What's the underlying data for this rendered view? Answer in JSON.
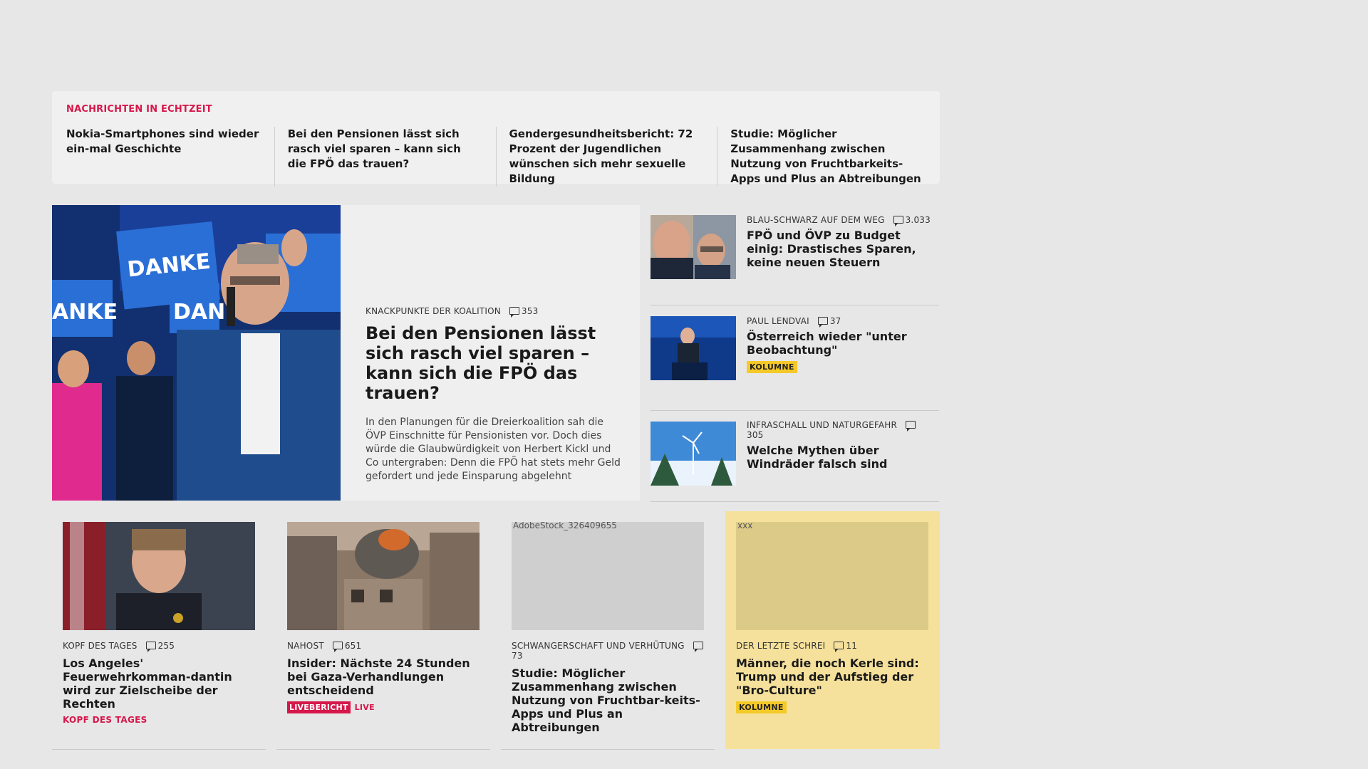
{
  "ticker": {
    "title": "NACHRICHTEN IN ECHTZEIT",
    "items": [
      {
        "label": "Nokia-Smartphones sind wieder ein-mal Geschichte"
      },
      {
        "label": "Bei den Pensionen lässt sich rasch viel sparen – kann sich die FPÖ das trauen?"
      },
      {
        "label": "Gendergesundheitsbericht: 72 Prozent der Jugendlichen wünschen sich mehr sexuelle Bildung"
      },
      {
        "label": "Studie: Möglicher Zusammenhang zwischen Nutzung von Fruchtbarkeits-Apps und Plus an Abtreibungen"
      }
    ]
  },
  "lead": {
    "kicker": "KNACKPUNKTE DER KOALITION",
    "comments": "353",
    "title": "Bei den Pensionen lässt sich rasch viel sparen – kann sich die FPÖ das trauen?",
    "teaser": "In den Planungen für die Dreierkoalition sah die ÖVP Einschnitte für Pensionisten vor. Doch dies würde die Glaubwürdigkeit von Herbert Kickl und Co untergraben: Denn die FPÖ hat stets mehr Geld gefordert und jede Einsparung abgelehnt",
    "image_signs": [
      "DANKE",
      "DANKE",
      "ANKE",
      "DAN"
    ]
  },
  "side": [
    {
      "kicker": "BLAU-SCHWARZ AUF DEM WEG",
      "comments": "3.033",
      "title": "FPÖ und ÖVP zu Budget einig: Drastisches Sparen, keine neuen Steuern"
    },
    {
      "kicker": "PAUL LENDVAI",
      "comments": "37",
      "title": "Österreich wieder \"unter Beobachtung\"",
      "tag": "KOLUMNE"
    },
    {
      "kicker": "INFRASCHALL UND NATURGEFAHR",
      "comments": "305",
      "title": "Welche Mythen über Windräder falsch sind"
    }
  ],
  "cards": [
    {
      "kicker": "KOPF DES TAGES",
      "comments": "255",
      "title": "Los Angeles' Feuerwehrkomman-dantin wird zur Zielscheibe der Rechten",
      "tag": "KOPF DES TAGES"
    },
    {
      "kicker": "NAHOST",
      "comments": "651",
      "title": "Insider: Nächste 24 Stunden bei Gaza-Verhandlungen entscheidend",
      "badge": "LIVEBERICHT",
      "live": "LIVE"
    },
    {
      "kicker": "SCHWANGERSCHAFT UND VERHÜTUNG",
      "comments": "73",
      "title": "Studie: Möglicher Zusammenhang zwischen Nutzung von Fruchtbar-keits-Apps und Plus an Abtreibungen",
      "img_alt": "AdobeStock_326409655"
    },
    {
      "kicker": "DER LETZTE SCHREI",
      "comments": "11",
      "title": "Männer, die noch Kerle sind: Trump und der Aufstieg der \"Bro-Culture\"",
      "tag": "KOLUMNE",
      "img_alt": "xxx"
    }
  ],
  "colors": {
    "accent": "#d6174a",
    "kolumne": "#f5c928",
    "yellow_card": "#f5e19b",
    "background": "#e7e7e7"
  }
}
